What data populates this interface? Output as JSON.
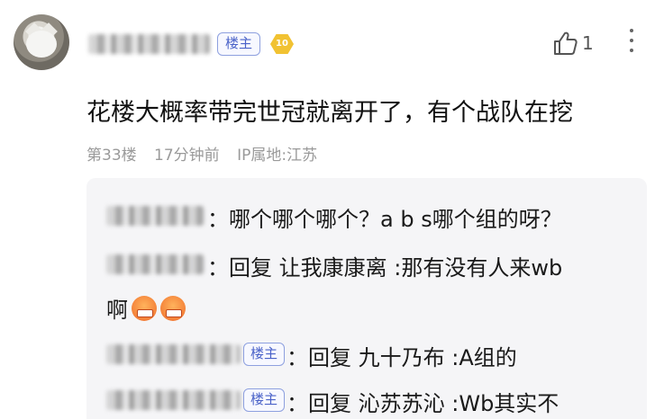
{
  "post": {
    "owner_tag": "楼主",
    "level": "10",
    "like_count": "1",
    "content": "花楼大概率带完世冠就离开了，有个战队在挖",
    "floor": "第33楼",
    "time": "17分钟前",
    "location": "IP属地:江苏"
  },
  "replies": [
    {
      "text": "哪个哪个哪个？a b s哪个组的呀？"
    },
    {
      "text": "回复 让我康康离 :那有没有人来wb",
      "text_cont": "啊"
    },
    {
      "tag": "楼主",
      "text": "回复 九十乃布 :A组的"
    },
    {
      "tag": "楼主",
      "text": "回复 沁苏苏沁 :Wb其实不"
    }
  ],
  "colors": {
    "tag_border": "#8ea0df",
    "tag_text": "#4a62c8",
    "badge": "#f1c232",
    "reply_bg": "#f5f5f7"
  }
}
